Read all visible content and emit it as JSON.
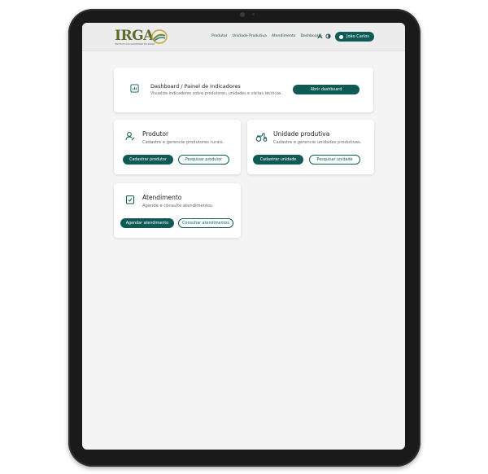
{
  "header": {
    "logo_text": "IRGA",
    "logo_subtitle": "INSTITUTO RIO GRANDENSE DO ARROZ",
    "nav": [
      "Produtor",
      "Unidade Produtiva",
      "Atendimento",
      "Dashboard"
    ],
    "user_name": "João Carlos"
  },
  "dashboard_card": {
    "title": "Dashboard / Painel de Indicadores",
    "subtitle": "Visualize indicadores sobre produtores, unidades e visitas técnicas.",
    "button": "Abrir dashboard"
  },
  "produtor_card": {
    "title": "Produtor",
    "subtitle": "Cadastre e gerencie produtores rurais.",
    "primary_button": "Cadastrar produtor",
    "secondary_button": "Pesquisar produtor"
  },
  "unidade_card": {
    "title": "Unidade produtiva",
    "subtitle": "Cadastre e gerencie unidades produtivas.",
    "primary_button": "Cadastrar unidade",
    "secondary_button": "Pesquisar unidade"
  },
  "atendimento_card": {
    "title": "Atendimento",
    "subtitle": "Agende e consulte atendimentos.",
    "primary_button": "Agendar atendimento",
    "secondary_button": "Consultar atendimentos"
  },
  "colors": {
    "primary": "#0f5a55",
    "logo": "#5c6b2e",
    "background": "#f4f4f4"
  }
}
